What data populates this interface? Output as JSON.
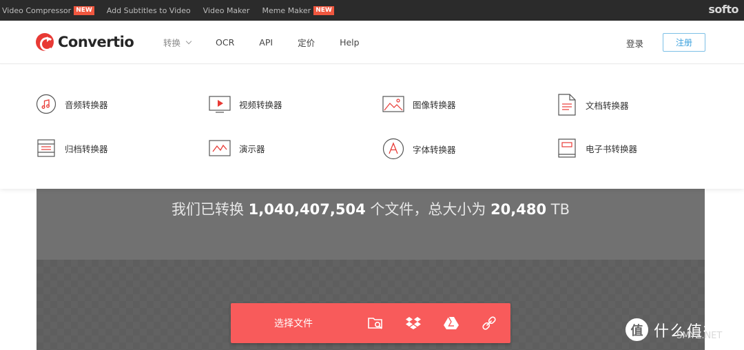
{
  "topbar": {
    "links": [
      {
        "label": "Video Compressor",
        "badge": "NEW"
      },
      {
        "label": "Add Subtitles to Video",
        "badge": ""
      },
      {
        "label": "Video Maker",
        "badge": ""
      },
      {
        "label": "Meme Maker",
        "badge": "NEW"
      }
    ],
    "brand": "softo"
  },
  "header": {
    "logo_text": "Convertio",
    "nav": [
      {
        "label": "转换",
        "has_dropdown": true
      },
      {
        "label": "OCR"
      },
      {
        "label": "API"
      },
      {
        "label": "定价"
      },
      {
        "label": "Help"
      }
    ],
    "login_label": "登录",
    "signup_label": "注册"
  },
  "menu": {
    "items": [
      {
        "label": "音频转换器",
        "icon": "music-note-icon"
      },
      {
        "label": "视频转换器",
        "icon": "video-screen-icon"
      },
      {
        "label": "图像转换器",
        "icon": "image-icon"
      },
      {
        "label": "文档转换器",
        "icon": "document-icon"
      },
      {
        "label": "归档转换器",
        "icon": "archive-icon"
      },
      {
        "label": "演示器",
        "icon": "presentation-icon"
      },
      {
        "label": "字体转换器",
        "icon": "font-icon"
      },
      {
        "label": "电子书转换器",
        "icon": "ebook-icon"
      }
    ]
  },
  "hero": {
    "stats_prefix": "我们已转换 ",
    "files_count": "1,040,407,504",
    "stats_middle": " 个文件，总大小为 ",
    "total_size": "20,480",
    "size_unit": " TB"
  },
  "upload": {
    "choose_label": "选择文件",
    "sources": [
      "folder-search-icon",
      "dropbox-icon",
      "google-drive-icon",
      "link-icon"
    ]
  },
  "watermark": {
    "mark": "值",
    "text": "什么值得买",
    "sub": "SMYZ.NET"
  },
  "colors": {
    "accent": "#f85b5b",
    "logo_red": "#e83a35",
    "signup_blue": "#3aa0dd",
    "badge": "#f0573f"
  }
}
